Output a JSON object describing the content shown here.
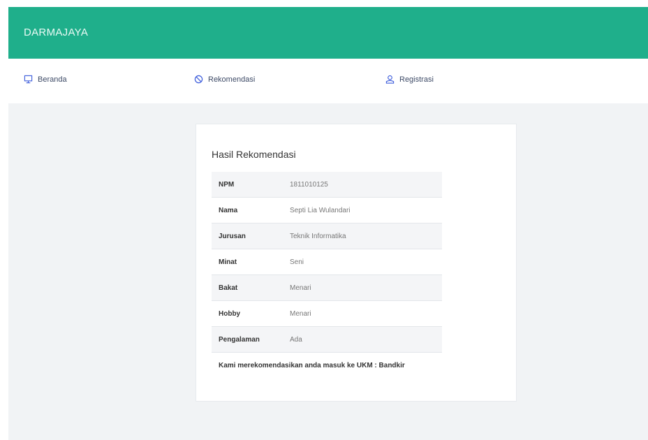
{
  "app": {
    "brand": "DARMAJAYA"
  },
  "nav": {
    "items": [
      {
        "label": "Beranda",
        "icon": "monitor-icon"
      },
      {
        "label": "Rekomendasi",
        "icon": "rekomendasi-icon"
      },
      {
        "label": "Registrasi",
        "icon": "user-icon"
      }
    ]
  },
  "result": {
    "title": "Hasil Rekomendasi",
    "rows": [
      {
        "label": "NPM",
        "value": "1811010125"
      },
      {
        "label": "Nama",
        "value": "Septi Lia Wulandari"
      },
      {
        "label": "Jurusan",
        "value": "Teknik Informatika"
      },
      {
        "label": "Minat",
        "value": "Seni"
      },
      {
        "label": "Bakat",
        "value": "Menari"
      },
      {
        "label": "Hobby",
        "value": "Menari"
      },
      {
        "label": "Pengalaman",
        "value": "Ada"
      }
    ],
    "note": "Kami merekomendasikan anda masuk ke UKM : Bandkir"
  },
  "colors": {
    "header": "#1faf8b",
    "content_bg": "#f1f3f5"
  }
}
